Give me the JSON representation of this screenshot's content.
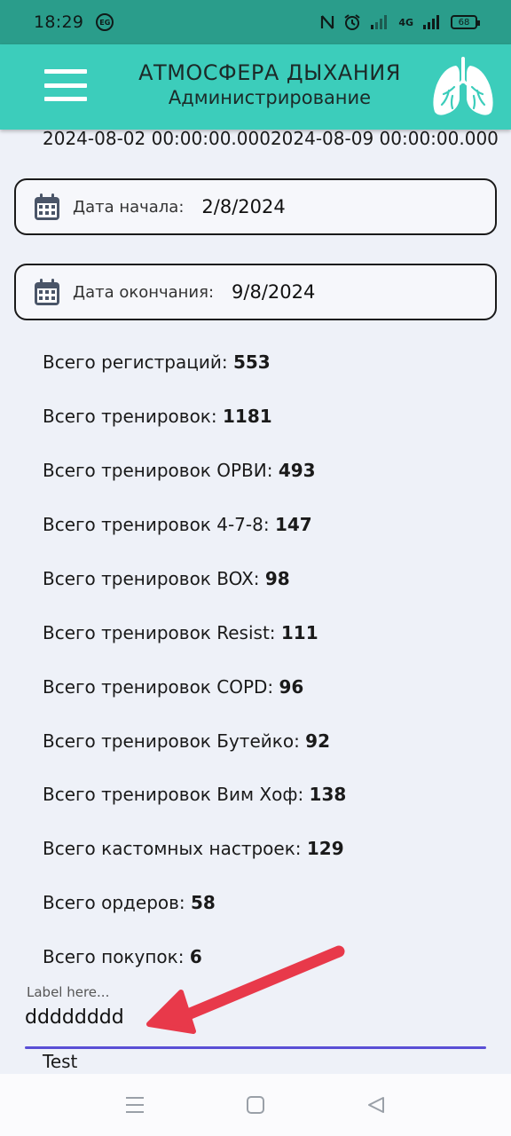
{
  "status_bar": {
    "time": "18:29",
    "badge": "EG",
    "battery": "68",
    "network": "4G",
    "colors": {
      "background": "#2a9d8b"
    }
  },
  "app_bar": {
    "title": "АТМОСФЕРА ДЫХАНИЯ",
    "subtitle": "Администрирование",
    "colors": {
      "background": "#3ccdbb"
    },
    "icons": [
      "hamburger-menu-icon",
      "lungs-icon"
    ]
  },
  "content": {
    "range_text": "2024-08-02 00:00:00.0002024-08-09 00:00:00.000",
    "start_date": {
      "label": "Дата начала:",
      "value": "2/8/2024",
      "icon": "calendar-icon"
    },
    "end_date": {
      "label": "Дата окончания:",
      "value": "9/8/2024",
      "icon": "calendar-icon"
    },
    "stats": [
      {
        "label": "Всего регистраций:",
        "value": "553"
      },
      {
        "label": "Всего тренировок:",
        "value": "1181"
      },
      {
        "label": "Всего тренировок ОРВИ:",
        "value": "493"
      },
      {
        "label": "Всего тренировок 4-7-8:",
        "value": "147"
      },
      {
        "label": "Всего тренировок BOX:",
        "value": "98"
      },
      {
        "label": "Всего тренировок Resist:",
        "value": "111"
      },
      {
        "label": "Всего тренировок COPD:",
        "value": "96"
      },
      {
        "label": "Всего тренировок Бутейко:",
        "value": "92"
      },
      {
        "label": "Всего тренировок Вим Хоф:",
        "value": "138"
      },
      {
        "label": "Всего кастомных настроек:",
        "value": "129"
      },
      {
        "label": "Всего ордеров:",
        "value": "58"
      },
      {
        "label": "Всего покупок:",
        "value": "6"
      }
    ],
    "text_field": {
      "label": "Label here...",
      "value": "dddddddd",
      "underline_color": "#5a4fd6"
    },
    "test_text": "Test",
    "annotation_arrow_color": "#e8394a"
  },
  "nav_bar": {
    "icons": [
      "menu-lines-icon",
      "home-square-icon",
      "back-triangle-icon"
    ]
  }
}
